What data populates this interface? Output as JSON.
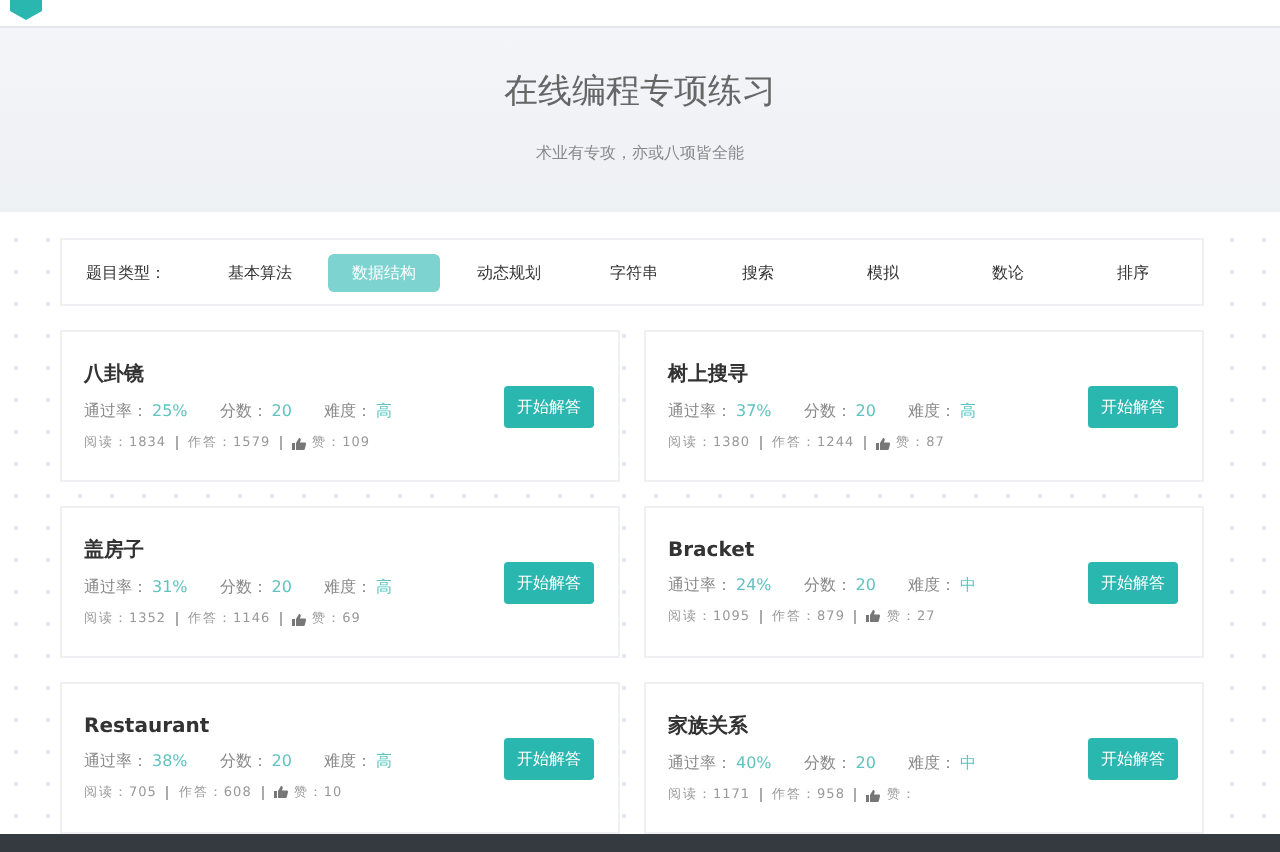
{
  "hero": {
    "title": "在线编程专项练习",
    "subtitle": "术业有专攻，亦或八项皆全能"
  },
  "filter": {
    "label": "题目类型：",
    "tags": [
      {
        "label": "基本算法",
        "selected": false
      },
      {
        "label": "数据结构",
        "selected": true
      },
      {
        "label": "动态规划",
        "selected": false
      },
      {
        "label": "字符串",
        "selected": false
      },
      {
        "label": "搜索",
        "selected": false
      },
      {
        "label": "模拟",
        "selected": false
      },
      {
        "label": "数论",
        "selected": false
      },
      {
        "label": "排序",
        "selected": false
      }
    ]
  },
  "problems": [
    {
      "title": "八卦镜",
      "pass_label": "通过率：",
      "pass": "25%",
      "score_label": "分数：",
      "score": "20",
      "difficulty_label": "难度：",
      "difficulty": "高",
      "reads": "阅读：1834",
      "answers": "作答：1579",
      "likes": "赞：109",
      "button": "开始解答"
    },
    {
      "title": "树上搜寻",
      "pass_label": "通过率：",
      "pass": "37%",
      "score_label": "分数：",
      "score": "20",
      "difficulty_label": "难度：",
      "difficulty": "高",
      "reads": "阅读：1380",
      "answers": "作答：1244",
      "likes": "赞：87",
      "button": "开始解答"
    },
    {
      "title": "盖房子",
      "pass_label": "通过率：",
      "pass": "31%",
      "score_label": "分数：",
      "score": "20",
      "difficulty_label": "难度：",
      "difficulty": "高",
      "reads": "阅读：1352",
      "answers": "作答：1146",
      "likes": "赞：69",
      "button": "开始解答"
    },
    {
      "title": "Bracket",
      "pass_label": "通过率：",
      "pass": "24%",
      "score_label": "分数：",
      "score": "20",
      "difficulty_label": "难度：",
      "difficulty": "中",
      "reads": "阅读：1095",
      "answers": "作答：879",
      "likes": "赞：27",
      "button": "开始解答"
    },
    {
      "title": "Restaurant",
      "pass_label": "通过率：",
      "pass": "38%",
      "score_label": "分数：",
      "score": "20",
      "difficulty_label": "难度：",
      "difficulty": "高",
      "reads": "阅读：705",
      "answers": "作答：608",
      "likes": "赞：10",
      "button": "开始解答"
    },
    {
      "title": "家族关系",
      "pass_label": "通过率：",
      "pass": "40%",
      "score_label": "分数：",
      "score": "20",
      "difficulty_label": "难度：",
      "difficulty": "中",
      "reads": "阅读：1171",
      "answers": "作答：958",
      "likes": "赞：",
      "button": "开始解答"
    }
  ]
}
